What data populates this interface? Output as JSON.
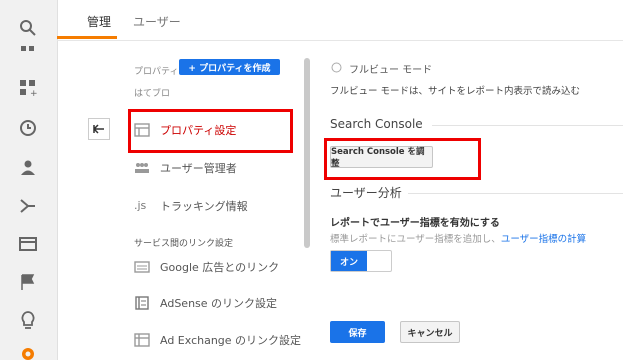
{
  "tabs": {
    "admin": "管理",
    "users": "ユーザー"
  },
  "rail": {
    "icons": [
      "search-icon",
      "home-icon",
      "customization-icon",
      "clock-icon",
      "person-icon",
      "acquisition-icon",
      "behavior-icon",
      "flag-icon",
      "lightbulb-icon",
      "gear-icon"
    ]
  },
  "property_column": {
    "label": "プロパティ",
    "create_button": "+ プロパティを作成",
    "property_name": "はてブロ",
    "items": [
      {
        "label": "プロパティ設定",
        "icon": "settings-page-icon"
      },
      {
        "label": "ユーザー管理者",
        "icon": "users-icon"
      },
      {
        "label": "トラッキング情報",
        "icon": "js-icon",
        "icon_text": ".js"
      }
    ],
    "linking_section_label": "サービス間のリンク設定",
    "linking_items": [
      {
        "label": "Google 広告とのリンク",
        "icon": "google-ads-icon"
      },
      {
        "label": "AdSense のリンク設定",
        "icon": "adsense-icon"
      },
      {
        "label": "Ad Exchange のリンク設定",
        "icon": "ad-exchange-icon"
      }
    ]
  },
  "main": {
    "fullview_radio_label": "フルビュー モード",
    "fullview_desc": "フルビュー モードは、サイトをレポート内表示で読み込む",
    "search_console_heading": "Search Console",
    "search_console_button": "Search Console を調整",
    "user_analysis_heading": "ユーザー分析",
    "user_metrics_title": "レポートでユーザー指標を有効にする",
    "user_metrics_desc_prefix": "標準レポートにユーザー指標を追加し、",
    "user_metrics_desc_link": "ユーザー指標の計算",
    "toggle_label": "オン",
    "save_button": "保存",
    "cancel_button": "キャンセル"
  },
  "colors": {
    "accent": "#f57c00",
    "primary": "#1a73e8",
    "highlight": "#e00000"
  }
}
